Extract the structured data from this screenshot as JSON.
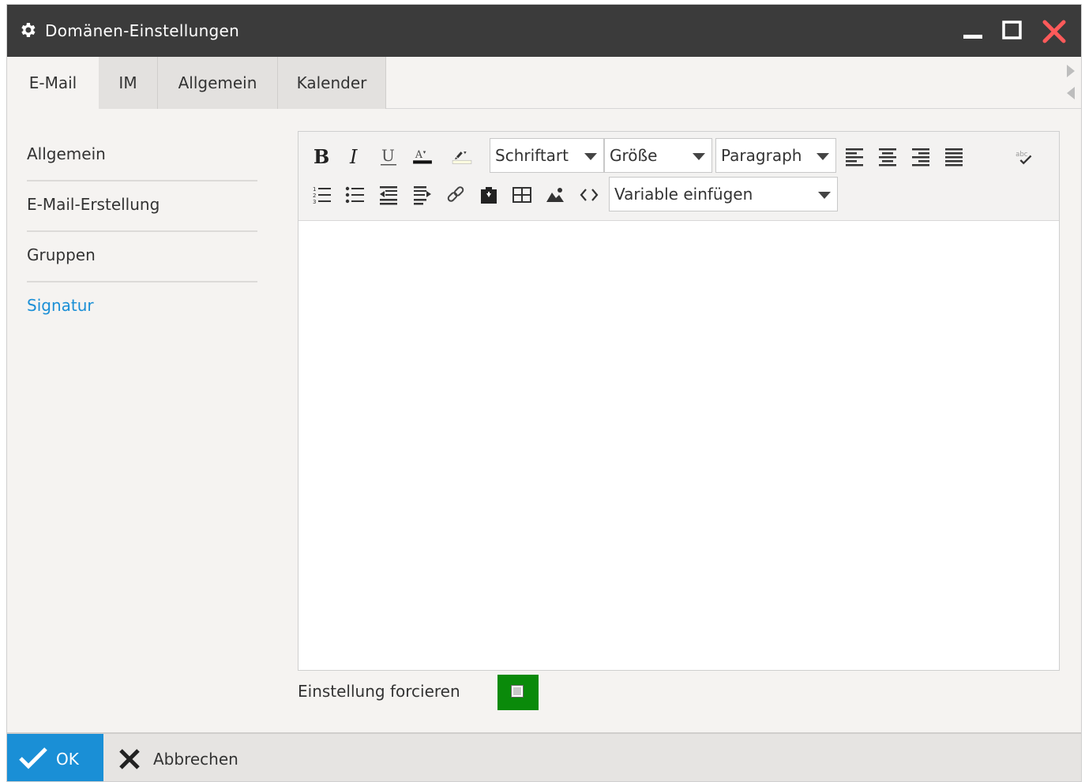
{
  "window": {
    "title": "Domänen-Einstellungen",
    "icons": {
      "app": "gear-icon",
      "minimize": "minimize-icon",
      "maximize": "maximize-icon",
      "close": "close-icon"
    },
    "colors": {
      "titlebar": "#3b3b3b",
      "close": "#ff5a5a"
    }
  },
  "tabs": [
    {
      "label": "E-Mail",
      "active": true
    },
    {
      "label": "IM",
      "active": false
    },
    {
      "label": "Allgemein",
      "active": false
    },
    {
      "label": "Kalender",
      "active": false
    }
  ],
  "sidebar": {
    "items": [
      {
        "label": "Allgemein",
        "active": false
      },
      {
        "label": "E-Mail-Erstellung",
        "active": false
      },
      {
        "label": "Gruppen",
        "active": false
      },
      {
        "label": "Signatur",
        "active": true
      }
    ],
    "active_color": "#1a8fd6"
  },
  "editor": {
    "selects": {
      "font": "Schriftart",
      "size": "Größe",
      "format": "Paragraph",
      "variable": "Variable einfügen"
    },
    "toolbar_icons": [
      "bold-icon",
      "italic-icon",
      "underline-icon",
      "font-color-icon",
      "highlight-color-icon",
      "align-left-icon",
      "align-center-icon",
      "align-right-icon",
      "align-justify-icon",
      "spellcheck-icon",
      "ordered-list-icon",
      "unordered-list-icon",
      "outdent-icon",
      "indent-icon",
      "link-icon",
      "paste-icon",
      "table-icon",
      "image-icon",
      "source-code-icon"
    ],
    "content": ""
  },
  "force": {
    "label": "Einstellung forcieren",
    "checked": false,
    "color": "#0a8a0a"
  },
  "footer": {
    "ok_label": "OK",
    "cancel_label": "Abbrechen",
    "ok_color": "#1a8fd6"
  }
}
